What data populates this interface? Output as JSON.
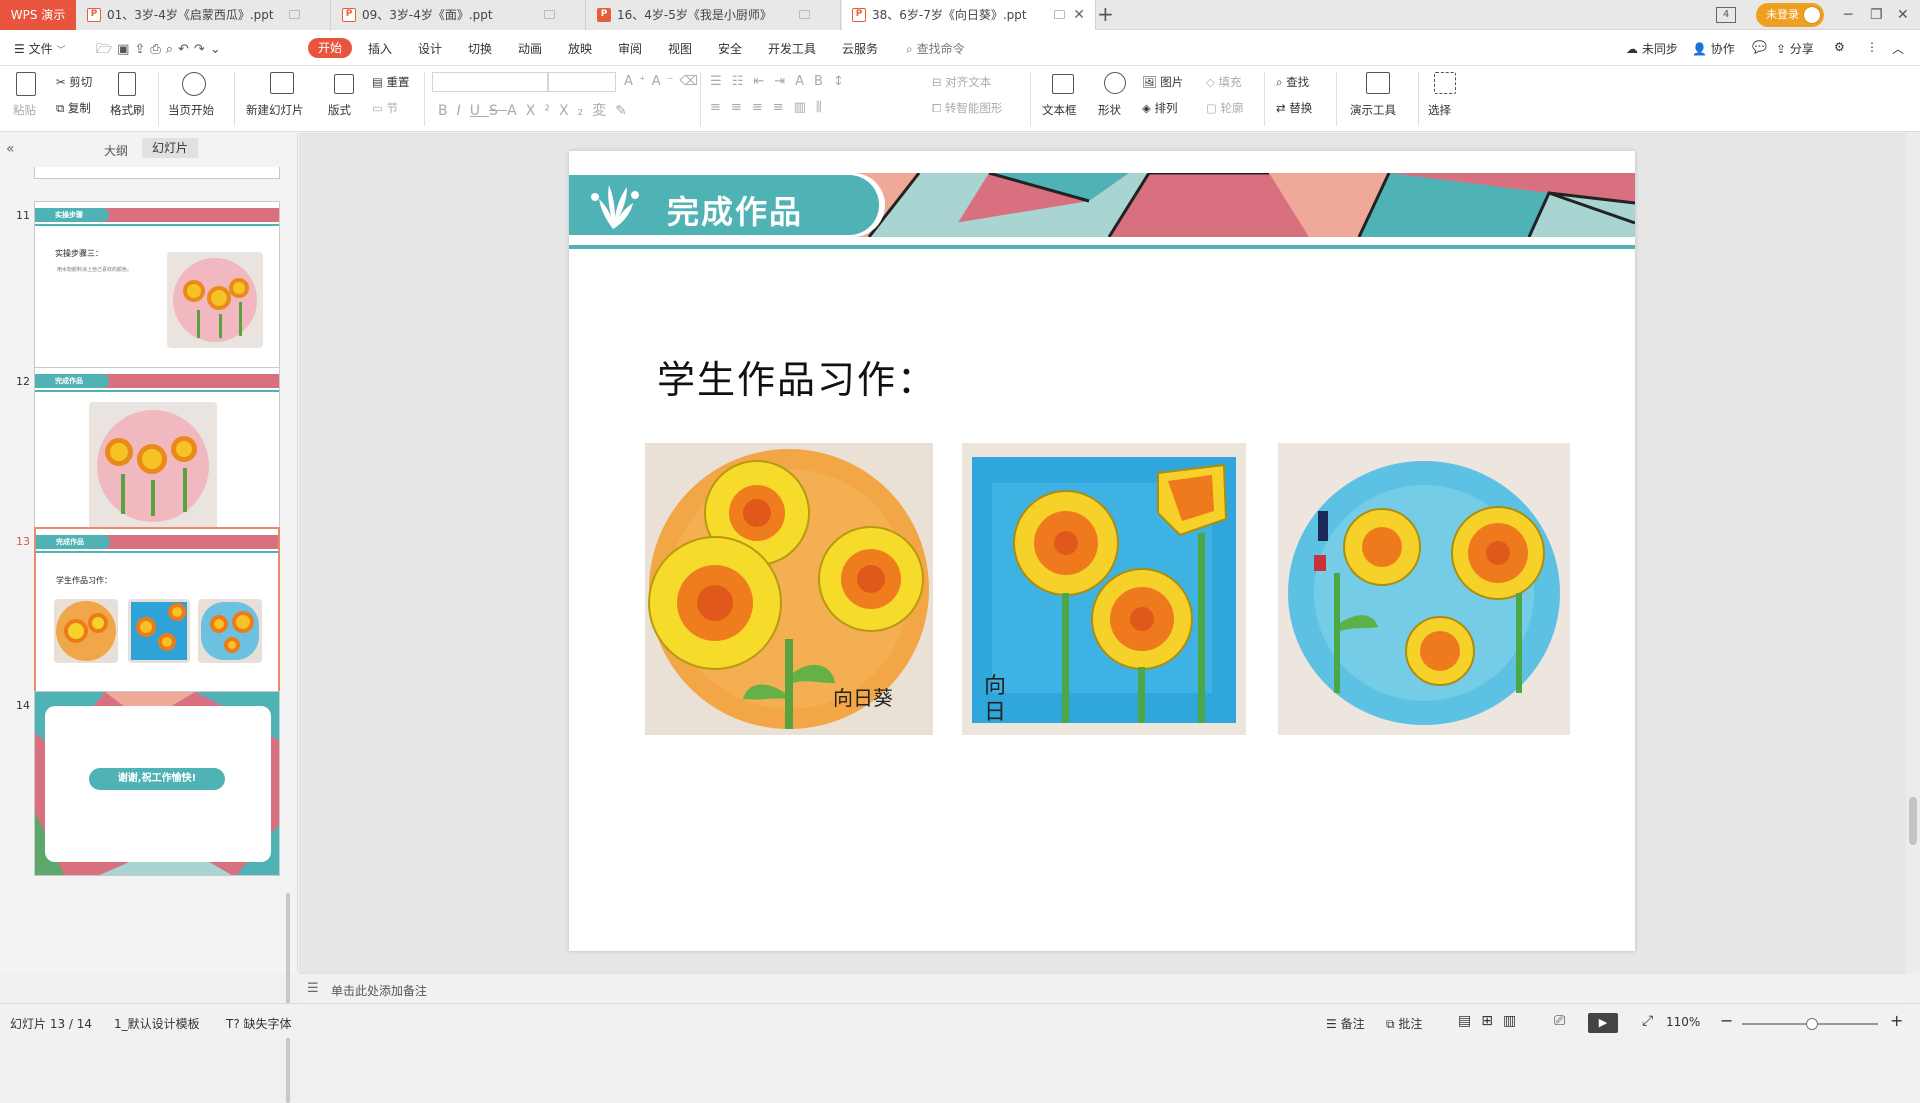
{
  "titlebar": {
    "app_name": "WPS 演示",
    "tabs": [
      {
        "label": "01、3岁-4岁《启蒙西瓜》.ppt",
        "icon": "ppt-file-icon"
      },
      {
        "label": "09、3岁-4岁《面》.ppt",
        "icon": "ppt-file-icon"
      },
      {
        "label": "16、4岁-5岁《我是小厨师》",
        "icon": "ppt-file-icon"
      },
      {
        "label": "38、6岁-7岁《向日葵》.ppt",
        "icon": "ppt-file-icon"
      }
    ],
    "new_tab": "+",
    "workspace_count": "4",
    "login_label": "未登录"
  },
  "menubar": {
    "file_label": "文件",
    "items": [
      "开始",
      "插入",
      "设计",
      "切换",
      "动画",
      "放映",
      "审阅",
      "视图",
      "安全",
      "开发工具",
      "云服务"
    ],
    "search_placeholder": "查找命令",
    "right_items": [
      "未同步",
      "协作",
      "分享"
    ]
  },
  "ribbon": {
    "paste": "粘贴",
    "cut": "剪切",
    "copy": "复制",
    "format_painter": "格式刷",
    "from_current": "当页开始",
    "new_slide": "新建幻灯片",
    "layout": "版式",
    "reset": "重置",
    "section": "节",
    "align_text": "对齐文本",
    "smart_graphic": "转智能图形",
    "textbox": "文本框",
    "shape": "形状",
    "picture": "图片",
    "arrange": "排列",
    "fill": "填充",
    "outline": "轮廓",
    "find": "查找",
    "replace": "替换",
    "presentation_tools": "演示工具",
    "select": "选择"
  },
  "leftpanel": {
    "tab_outline": "大纲",
    "tab_slides": "幻灯片",
    "slides": [
      {
        "num": "11",
        "header": "实操步骤",
        "title": "实操步骤三：",
        "subtitle": "用水粉颜料涂上自己喜欢的颜色。"
      },
      {
        "num": "12",
        "header": "完成作品"
      },
      {
        "num": "13",
        "header": "完成作品",
        "title": "学生作品习作："
      },
      {
        "num": "14",
        "message": "谢谢,祝工作愉快!"
      }
    ]
  },
  "slide": {
    "header_title": "完成作品",
    "main_text": "学生作品习作："
  },
  "notes": {
    "placeholder": "单击此处添加备注"
  },
  "statusbar": {
    "slide_counter": "幻灯片 13 / 14",
    "template": "1_默认设计模板",
    "missing_font": "缺失字体",
    "notes_btn": "备注",
    "comment_btn": "批注",
    "zoom": "110%"
  },
  "colors": {
    "accent": "#e9543f",
    "teal": "#4fb3b6",
    "rose": "#d87080",
    "salmon": "#f0a898",
    "mint": "#a8d5d1"
  }
}
